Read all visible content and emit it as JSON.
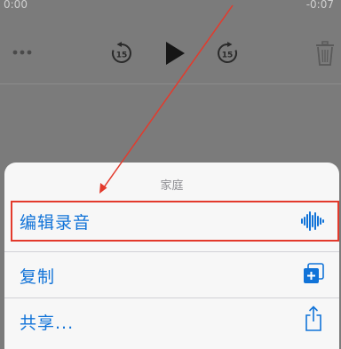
{
  "player": {
    "elapsed": "0:00",
    "remaining": "-0:07",
    "controls": [
      "more-icon",
      "skip-back-15-icon",
      "play-icon",
      "skip-forward-15-icon",
      "trash-icon"
    ],
    "skip_back_label": "15",
    "skip_forward_label": "15"
  },
  "sheet": {
    "title": "家庭",
    "items": [
      {
        "label": "编辑录音",
        "icon": "waveform-icon",
        "highlighted": true
      },
      {
        "label": "复制",
        "icon": "duplicate-icon"
      },
      {
        "label": "共享...",
        "icon": "share-icon"
      }
    ]
  },
  "colors": {
    "accent": "#1173d8",
    "annotation": "#e33a2c",
    "overlay": "#7b7b7b",
    "sheet_bg": "#f7f7f7"
  }
}
